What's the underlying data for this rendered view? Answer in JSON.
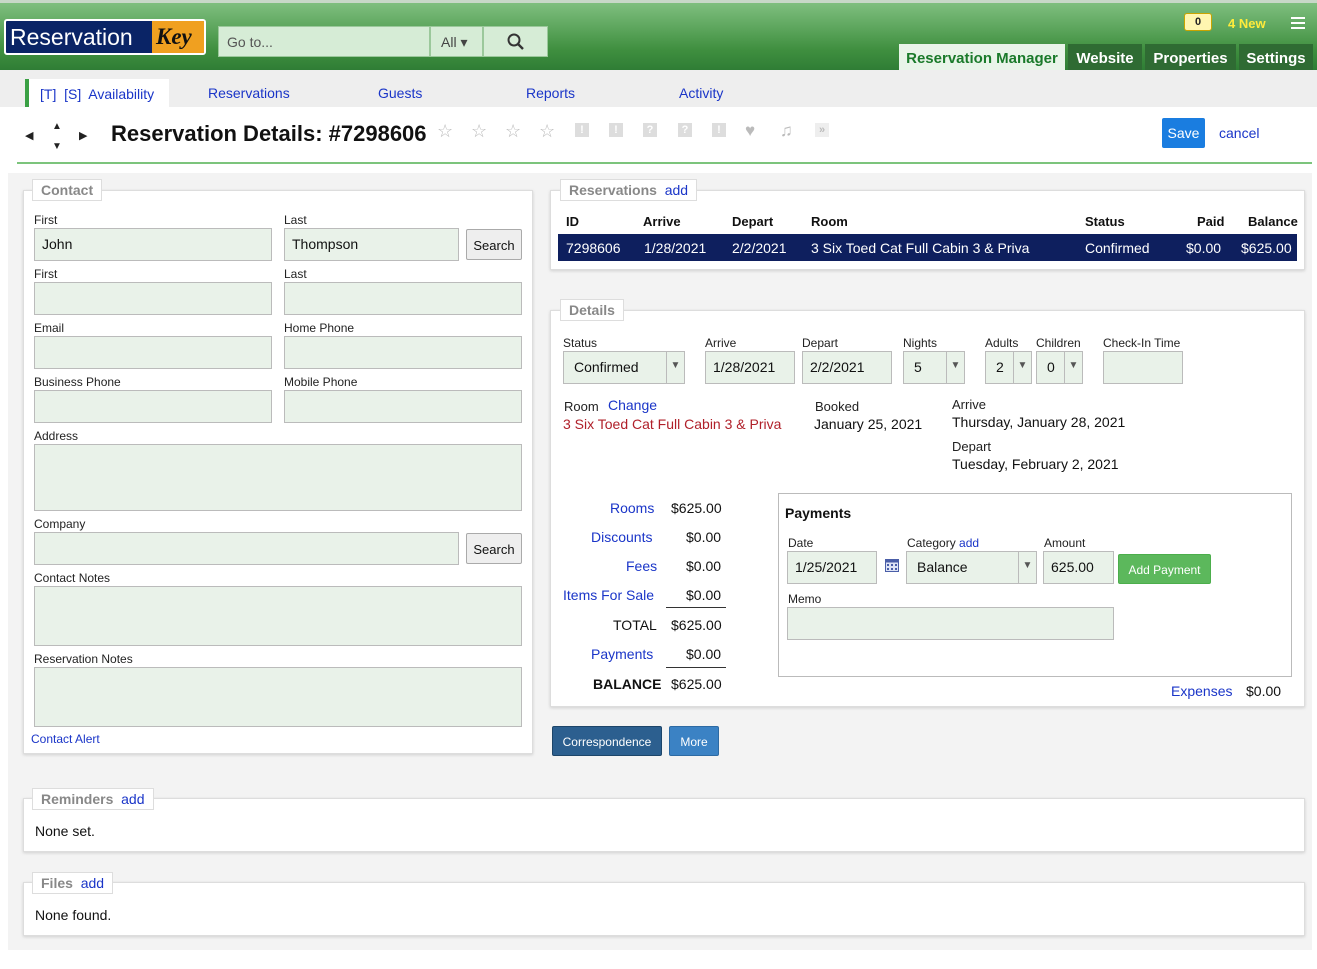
{
  "logo": {
    "part1": "Reservation",
    "part2": "Key"
  },
  "header": {
    "goto_placeholder": "Go to...",
    "all_label": "All ▾",
    "notif_count": "0",
    "new_label": "4 New"
  },
  "main_tabs": [
    "Reservation Manager",
    "Website",
    "Properties",
    "Settings"
  ],
  "subnav": {
    "availability": "[T]  [S]  Availability",
    "reservations": "Reservations",
    "guests": "Guests",
    "reports": "Reports",
    "activity": "Activity"
  },
  "title": "Reservation Details: #7298606",
  "actions": {
    "save": "Save",
    "cancel": "cancel"
  },
  "contact": {
    "legend": "Contact",
    "first_label": "First",
    "first_value": "John",
    "last_label": "Last",
    "last_value": "Thompson",
    "search": "Search",
    "first2_label": "First",
    "last2_label": "Last",
    "email_label": "Email",
    "home_phone_label": "Home Phone",
    "business_phone_label": "Business Phone",
    "mobile_phone_label": "Mobile Phone",
    "address_label": "Address",
    "company_label": "Company",
    "company_search": "Search",
    "contact_notes_label": "Contact Notes",
    "reservation_notes_label": "Reservation Notes",
    "contact_alert": "Contact Alert"
  },
  "reservations": {
    "legend": "Reservations",
    "add": "add",
    "headers": [
      "ID",
      "Arrive",
      "Depart",
      "Room",
      "Status",
      "Paid",
      "Balance"
    ],
    "row": [
      "7298606",
      "1/28/2021",
      "2/2/2021",
      "3 Six Toed Cat Full Cabin 3 & Priva",
      "Confirmed",
      "$0.00",
      "$625.00"
    ]
  },
  "details": {
    "legend": "Details",
    "status_label": "Status",
    "status_value": "Confirmed",
    "arrive_label": "Arrive",
    "arrive_value": "1/28/2021",
    "depart_label": "Depart",
    "depart_value": "2/2/2021",
    "nights_label": "Nights",
    "nights_value": "5",
    "adults_label": "Adults",
    "adults_value": "2",
    "children_label": "Children",
    "children_value": "0",
    "checkin_label": "Check-In Time",
    "room_label": "Room",
    "room_change": "Change",
    "room_value": "3 Six Toed Cat Full Cabin 3 & Priva",
    "booked_label": "Booked",
    "booked_value": "January 25, 2021",
    "arrive_long_label": "Arrive",
    "arrive_long": "Thursday, January 28, 2021",
    "depart_long_label": "Depart",
    "depart_long": "Tuesday, February 2, 2021"
  },
  "totals": {
    "rooms_label": "Rooms",
    "rooms": "$625.00",
    "discounts_label": "Discounts",
    "discounts": "$0.00",
    "fees_label": "Fees",
    "fees": "$0.00",
    "items_label": "Items For Sale",
    "items": "$0.00",
    "total_label": "TOTAL",
    "total": "$625.00",
    "payments_label": "Payments",
    "payments": "$0.00",
    "balance_label": "BALANCE",
    "balance": "$625.00"
  },
  "payments": {
    "title": "Payments",
    "date_label": "Date",
    "date_value": "1/25/2021",
    "category_label": "Category",
    "category_add": "add",
    "category_value": "Balance",
    "amount_label": "Amount",
    "amount_value": "625.00",
    "add_payment": "Add Payment",
    "memo_label": "Memo",
    "expenses_label": "Expenses",
    "expenses_value": "$0.00"
  },
  "buttons": {
    "correspondence": "Correspondence",
    "more": "More"
  },
  "reminders": {
    "legend": "Reminders",
    "add": "add",
    "text": "None set."
  },
  "files": {
    "legend": "Files",
    "add": "add",
    "text": "None found."
  }
}
